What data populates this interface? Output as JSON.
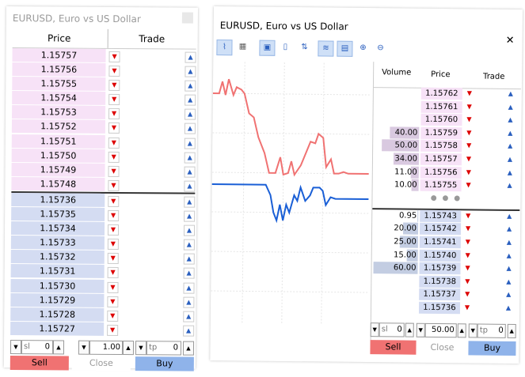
{
  "left": {
    "title": "EURUSD, Euro vs US Dollar",
    "col_price": "Price",
    "col_trade": "Trade",
    "asks": [
      "1.15757",
      "1.15756",
      "1.15755",
      "1.15754",
      "1.15753",
      "1.15752",
      "1.15751",
      "1.15750",
      "1.15749",
      "1.15748"
    ],
    "bids": [
      "1.15736",
      "1.15735",
      "1.15734",
      "1.15733",
      "1.15732",
      "1.15731",
      "1.15730",
      "1.15729",
      "1.15728",
      "1.15727"
    ],
    "sl_label": "sl",
    "sl_value": "0",
    "volume": "1.00",
    "tp_label": "tp",
    "tp_value": "0",
    "sell": "Sell",
    "close": "Close",
    "buy": "Buy"
  },
  "right": {
    "title": "EURUSD, Euro vs US Dollar",
    "col_volume": "Volume",
    "col_price": "Price",
    "col_trade": "Trade",
    "asks": [
      {
        "vol": "",
        "price": "1.15762"
      },
      {
        "vol": "",
        "price": "1.15761"
      },
      {
        "vol": "",
        "price": "1.15760"
      },
      {
        "vol": "40.00",
        "price": "1.15759"
      },
      {
        "vol": "50.00",
        "price": "1.15758"
      },
      {
        "vol": "34.00",
        "price": "1.15757"
      },
      {
        "vol": "11.00",
        "price": "1.15756"
      },
      {
        "vol": "10.00",
        "price": "1.15755"
      }
    ],
    "separator": "● ● ●",
    "bids": [
      {
        "vol": "0.95",
        "price": "1.15743"
      },
      {
        "vol": "20.00",
        "price": "1.15742"
      },
      {
        "vol": "25.00",
        "price": "1.15741"
      },
      {
        "vol": "15.00",
        "price": "1.15740"
      },
      {
        "vol": "60.00",
        "price": "1.15739"
      },
      {
        "vol": "",
        "price": "1.15738"
      },
      {
        "vol": "",
        "price": "1.15737"
      },
      {
        "vol": "",
        "price": "1.15736"
      }
    ],
    "sl_label": "sl",
    "sl_value": "0",
    "volume": "50.00",
    "tp_label": "tp",
    "tp_value": "0",
    "sell": "Sell",
    "close": "Close",
    "buy": "Buy",
    "colors": {
      "ask_line": "#f07272",
      "bid_line": "#1a5fd6"
    }
  }
}
